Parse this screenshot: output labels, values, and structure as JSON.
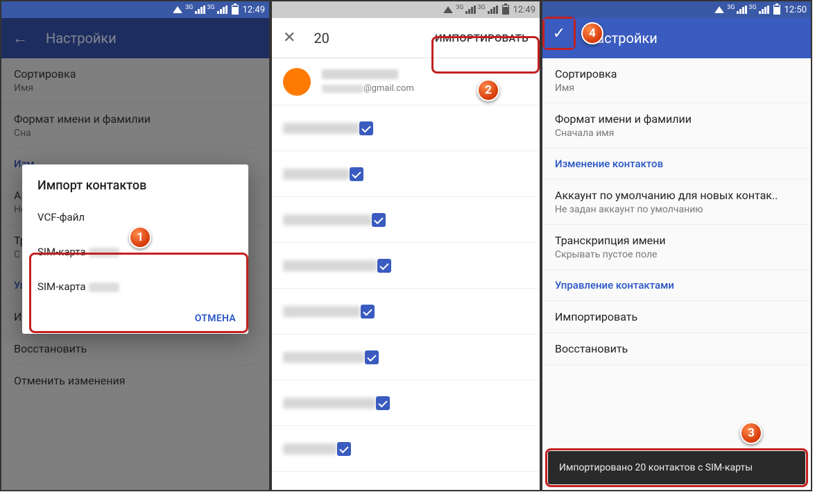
{
  "status": {
    "time_left": "12:49",
    "time_mid": "12:49",
    "time_right": "12:50",
    "net": "3G"
  },
  "screen1": {
    "title": "Настройки",
    "items": [
      {
        "t": "Сортировка",
        "s": "Имя"
      },
      {
        "t": "Формат имени и фамилии",
        "s": "Сна"
      },
      {
        "t": "Изм",
        "section": true
      },
      {
        "t": "Ак",
        "s": "Не"
      },
      {
        "t": "Тр",
        "s": "С"
      },
      {
        "t": "Упр",
        "section": true
      },
      {
        "t": "Импортировать"
      },
      {
        "t": "Восстановить"
      },
      {
        "t": "Отменить изменения"
      }
    ],
    "dialog": {
      "title": "Импорт контактов",
      "opt_vcf": "VCF-файл",
      "opt_sim1": "SIM-карта",
      "opt_sim2": "SIM-карта",
      "cancel": "ОТМЕНА"
    }
  },
  "screen2": {
    "count": "20",
    "import_btn": "ИМПОРТИРОВАТЬ",
    "email_suffix": "@gmail.com",
    "row_widths": [
      110,
      96,
      128,
      136,
      112,
      118,
      134,
      78
    ]
  },
  "screen3": {
    "title": "Настройки",
    "items": [
      {
        "t": "Сортировка",
        "s": "Имя"
      },
      {
        "t": "Формат имени и фамилии",
        "s": "Сначала имя"
      },
      {
        "t": "Изменение контактов",
        "section": true
      },
      {
        "t": "Аккаунт по умолчанию для новых контак..",
        "s": "Не задан аккаунт по умолчанию"
      },
      {
        "t": "Транскрипция имени",
        "s": "Скрывать пустое поле"
      },
      {
        "t": "Управление контактами",
        "section": true
      },
      {
        "t": "Импортировать"
      },
      {
        "t": "Восстановить"
      }
    ],
    "toast": "Импортировано 20 контактов с SIM-карты"
  },
  "callouts": {
    "n1": "1",
    "n2": "2",
    "n3": "3",
    "n4": "4",
    "check": "✓"
  }
}
